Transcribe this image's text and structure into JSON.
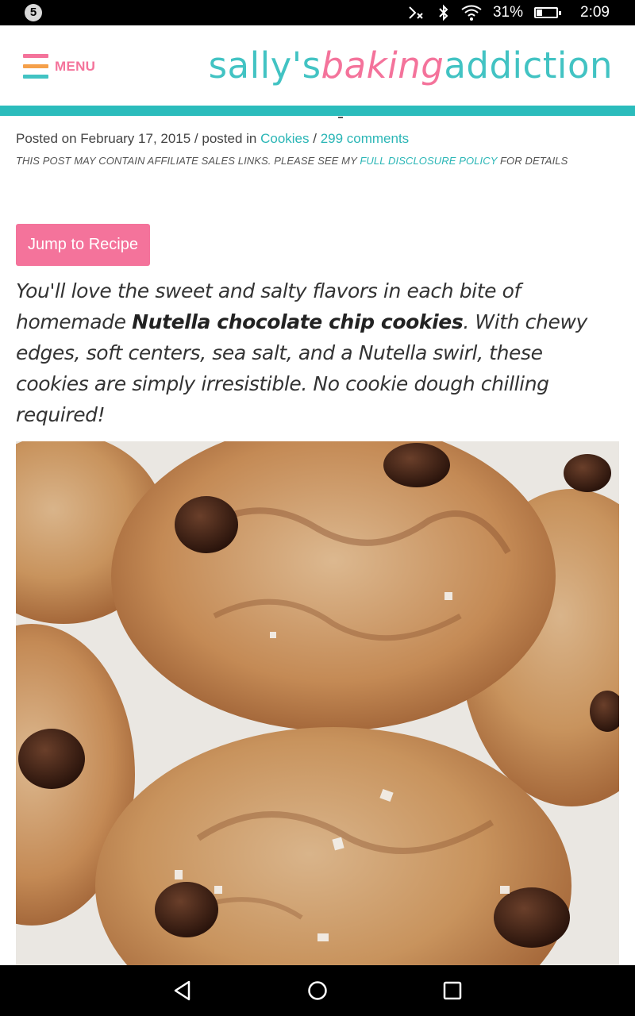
{
  "status_bar": {
    "notification_count": "5",
    "battery_percent": "31%",
    "battery_level": 0.31,
    "time": "2:09",
    "icons": [
      "bluetooth-muted-icon",
      "bluetooth-icon",
      "wifi-icon",
      "battery-icon"
    ]
  },
  "header": {
    "menu_label": "MENU",
    "menu_bar_colors": [
      "#f4739b",
      "#f5a04a",
      "#42c3c3"
    ],
    "logo": {
      "part1": "sally's",
      "part2": "baking",
      "part3": "addiction"
    },
    "accent_teal": "#2bbcbc",
    "accent_pink": "#f4739b"
  },
  "post": {
    "posted_prefix": "Posted on February 17, 2015 / posted in ",
    "category": "Cookies",
    "separator": " / ",
    "comments": "299 comments",
    "disclosure_prefix": "THIS POST MAY CONTAIN AFFILIATE SALES LINKS. PLEASE SEE MY ",
    "disclosure_link": "FULL DISCLOSURE POLICY",
    "disclosure_suffix": " FOR DETAILS",
    "jump_button": "Jump to Recipe",
    "intro_part1": "You'll love the sweet and salty flavors in each bite of homemade ",
    "intro_bold": "Nutella chocolate chip cookies",
    "intro_part2": ". With chewy edges, soft centers, sea salt, and a Nutella swirl, these cookies are simply irresistible. No cookie dough chilling required!"
  },
  "nav_bar": {
    "icons": [
      "back-icon",
      "home-icon",
      "recents-icon"
    ]
  }
}
